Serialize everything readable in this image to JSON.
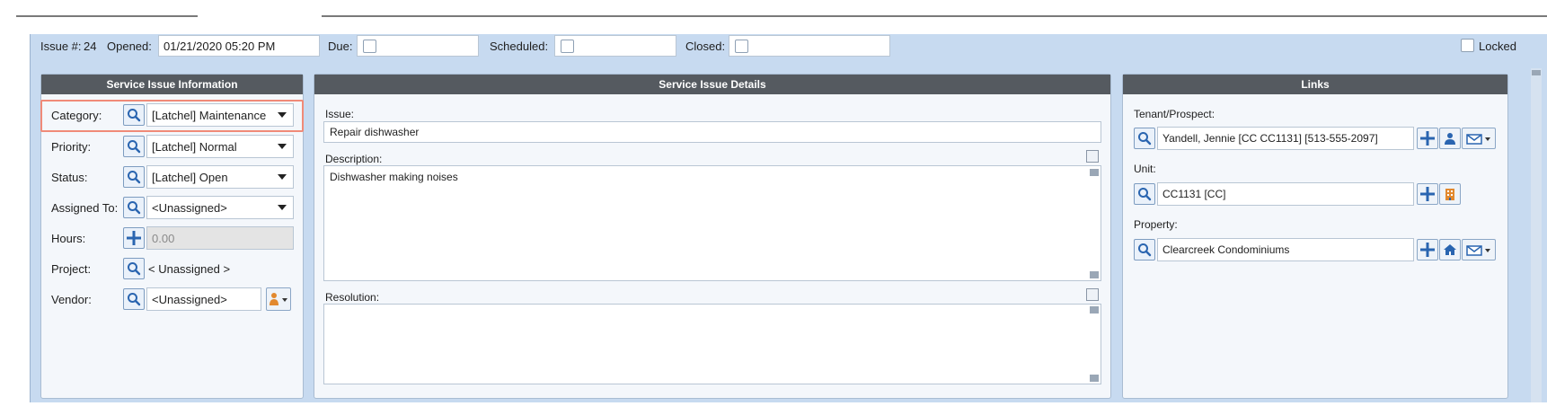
{
  "header": {
    "issue_label": "Issue #:",
    "issue_number": "24",
    "opened_label": "Opened:",
    "opened_value": "01/21/2020 05:20 PM",
    "due_label": "Due:",
    "scheduled_label": "Scheduled:",
    "closed_label": "Closed:",
    "locked_label": "Locked"
  },
  "left_panel": {
    "title": "Service Issue Information",
    "category": {
      "label": "Category:",
      "value": "[Latchel] Maintenance"
    },
    "priority": {
      "label": "Priority:",
      "value": "[Latchel] Normal"
    },
    "status": {
      "label": "Status:",
      "value": "[Latchel] Open"
    },
    "assigned_to": {
      "label": "Assigned To:",
      "value": "<Unassigned>"
    },
    "hours": {
      "label": "Hours:",
      "value": "0.00"
    },
    "project": {
      "label": "Project:",
      "value": "< Unassigned >"
    },
    "vendor": {
      "label": "Vendor:",
      "value": "<Unassigned>"
    }
  },
  "middle_panel": {
    "title": "Service Issue Details",
    "issue_label": "Issue:",
    "issue_value": "Repair dishwasher",
    "description_label": "Description:",
    "description_value": "Dishwasher making noises",
    "resolution_label": "Resolution:",
    "resolution_value": ""
  },
  "right_panel": {
    "title": "Links",
    "tenant_label": "Tenant/Prospect:",
    "tenant_value": "Yandell, Jennie [CC CC1131] [513-555-2097]",
    "unit_label": "Unit:",
    "unit_value": "CC1131 [CC]",
    "property_label": "Property:",
    "property_value": "Clearcreek Condominiums"
  },
  "colors": {
    "accent_blue": "#2a65b0",
    "highlight": "#f08a78",
    "panel_header": "#555a60",
    "background": "#c7daf0"
  }
}
